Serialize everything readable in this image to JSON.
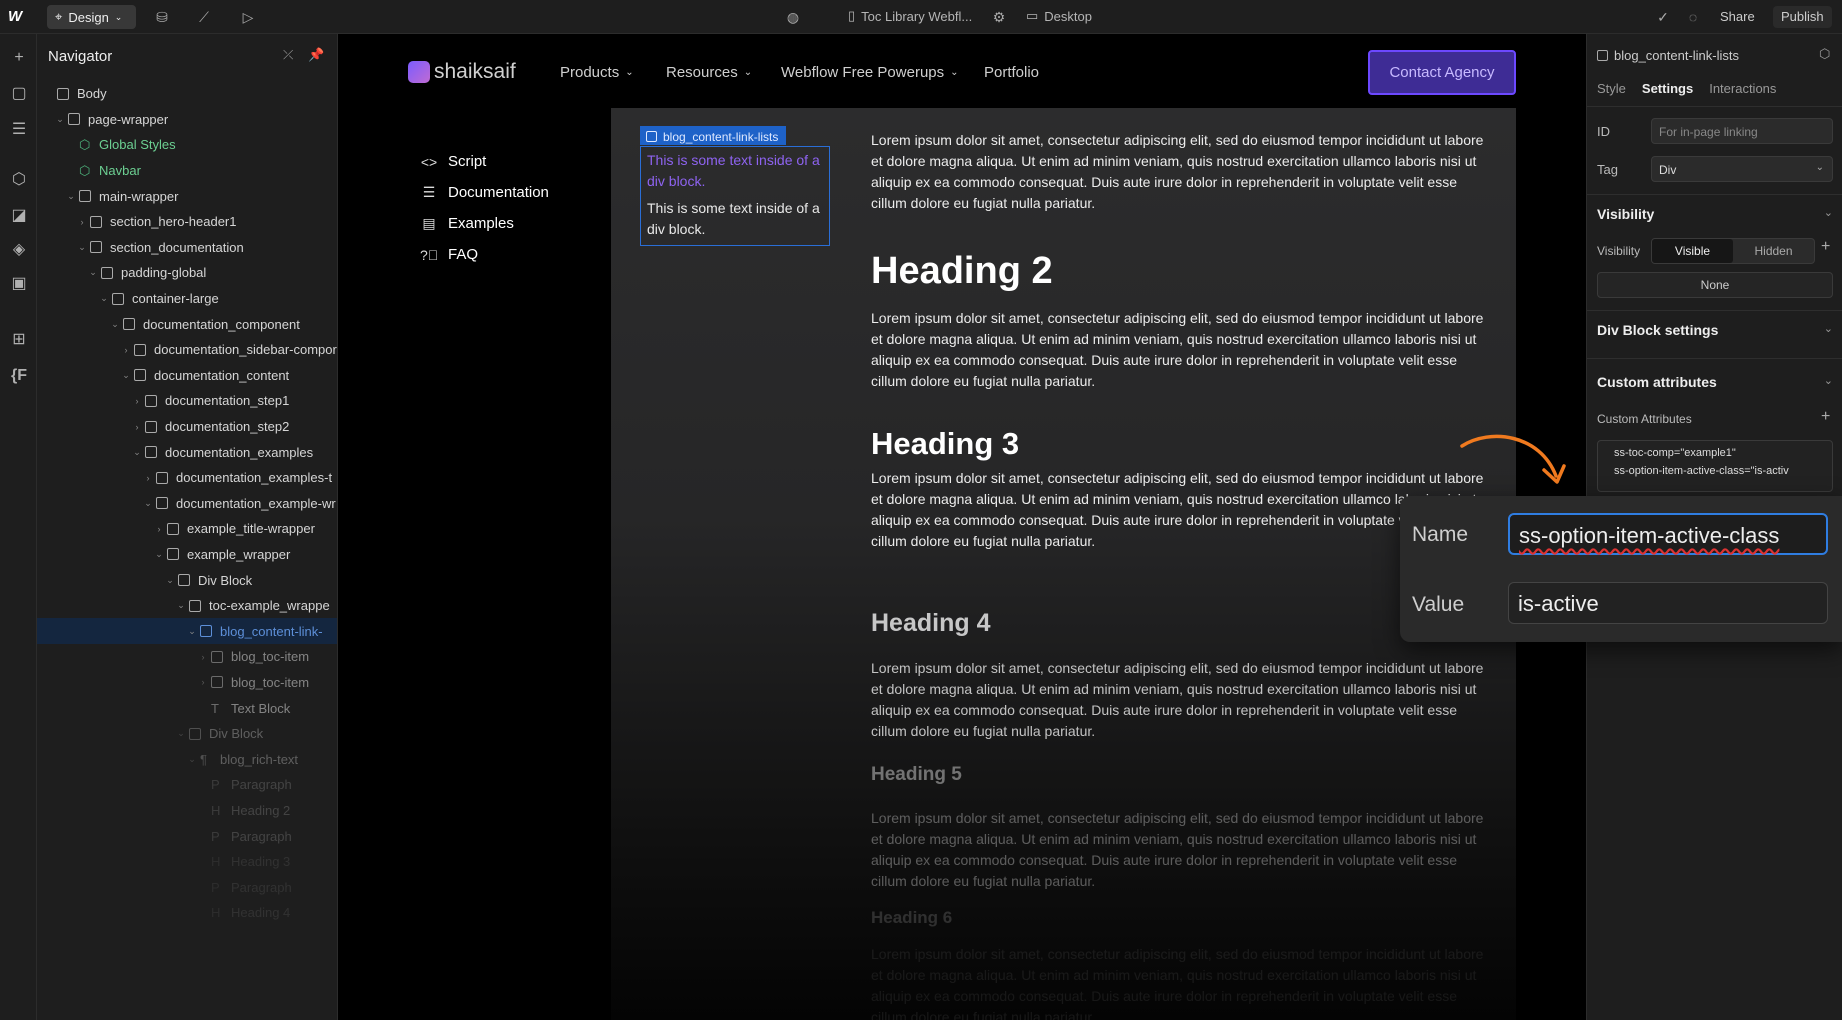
{
  "topbar": {
    "logo": "W",
    "mode_label": "Design",
    "page_name": "Toc Library Webfl...",
    "breakpoint_label": "Desktop",
    "share_label": "Share",
    "publish_label": "Publish"
  },
  "navigator": {
    "title": "Navigator",
    "tree": [
      {
        "label": "Body",
        "depth": 0,
        "chev": "",
        "kind": "box"
      },
      {
        "label": "page-wrapper",
        "depth": 1,
        "chev": "v",
        "kind": "box"
      },
      {
        "label": "Global Styles",
        "depth": 2,
        "chev": "",
        "kind": "component"
      },
      {
        "label": "Navbar",
        "depth": 2,
        "chev": "",
        "kind": "component"
      },
      {
        "label": "main-wrapper",
        "depth": 2,
        "chev": "v",
        "kind": "box"
      },
      {
        "label": "section_hero-header1",
        "depth": 3,
        "chev": ">",
        "kind": "box"
      },
      {
        "label": "section_documentation",
        "depth": 3,
        "chev": "v",
        "kind": "box"
      },
      {
        "label": "padding-global",
        "depth": 4,
        "chev": "v",
        "kind": "box"
      },
      {
        "label": "container-large",
        "depth": 5,
        "chev": "v",
        "kind": "box"
      },
      {
        "label": "documentation_component",
        "depth": 6,
        "chev": "v",
        "kind": "box"
      },
      {
        "label": "documentation_sidebar-compor",
        "depth": 7,
        "chev": ">",
        "kind": "box"
      },
      {
        "label": "documentation_content",
        "depth": 7,
        "chev": "v",
        "kind": "box"
      },
      {
        "label": "documentation_step1",
        "depth": 8,
        "chev": ">",
        "kind": "box"
      },
      {
        "label": "documentation_step2",
        "depth": 8,
        "chev": ">",
        "kind": "box"
      },
      {
        "label": "documentation_examples",
        "depth": 8,
        "chev": "v",
        "kind": "box"
      },
      {
        "label": "documentation_examples-t",
        "depth": 9,
        "chev": ">",
        "kind": "box"
      },
      {
        "label": "documentation_example-wr",
        "depth": 9,
        "chev": "v",
        "kind": "box"
      },
      {
        "label": "example_title-wrapper",
        "depth": 10,
        "chev": ">",
        "kind": "box"
      },
      {
        "label": "example_wrapper",
        "depth": 10,
        "chev": "v",
        "kind": "box"
      },
      {
        "label": "Div Block",
        "depth": 11,
        "chev": "v",
        "kind": "box"
      },
      {
        "label": "toc-example_wrappe",
        "depth": 12,
        "chev": "v",
        "kind": "box"
      },
      {
        "label": "blog_content-link-",
        "depth": 13,
        "chev": "v",
        "kind": "box",
        "selected": true
      },
      {
        "label": "blog_toc-item",
        "depth": 14,
        "chev": ">",
        "kind": "box",
        "fade": 1
      },
      {
        "label": "blog_toc-item",
        "depth": 14,
        "chev": ">",
        "kind": "box",
        "fade": 1
      },
      {
        "label": "Text Block",
        "depth": 14,
        "chev": "",
        "kind": "text",
        "fade": 1
      },
      {
        "label": "Div Block",
        "depth": 12,
        "chev": "v",
        "kind": "box",
        "fade": 2
      },
      {
        "label": "blog_rich-text",
        "depth": 13,
        "chev": "v",
        "kind": "rich",
        "fade": 2
      },
      {
        "label": "Paragraph",
        "depth": 14,
        "chev": "",
        "kind": "para",
        "fade": 3
      },
      {
        "label": "Heading 2",
        "depth": 14,
        "chev": "",
        "kind": "heading",
        "fade": 3
      },
      {
        "label": "Paragraph",
        "depth": 14,
        "chev": "",
        "kind": "para",
        "fade": 3
      },
      {
        "label": "Heading 3",
        "depth": 14,
        "chev": "",
        "kind": "heading",
        "fade": 4
      },
      {
        "label": "Paragraph",
        "depth": 14,
        "chev": "",
        "kind": "para",
        "fade": 4
      },
      {
        "label": "Heading 4",
        "depth": 14,
        "chev": "",
        "kind": "heading",
        "fade": 4
      }
    ]
  },
  "site": {
    "brand": "shaiksaif",
    "nav": [
      "Products",
      "Resources",
      "Webflow Free Powerups",
      "Portfolio"
    ],
    "cta_label": "Contact Agency",
    "sidebar": [
      "Script",
      "Documentation",
      "Examples",
      "FAQ"
    ],
    "toc_class_label": "blog_content-link-lists",
    "toc_texts": [
      "This is some text inside of a div block.",
      "This is some text inside of a div block."
    ],
    "paragraph": "Lorem ipsum dolor sit amet, consectetur adipiscing elit, sed do eiusmod tempor incididunt ut labore et dolore magna aliqua. Ut enim ad minim veniam, quis nostrud exercitation ullamco laboris nisi ut aliquip ex ea commodo consequat. Duis aute irure dolor in reprehenderit in voluptate velit esse cillum dolore eu fugiat nulla pariatur.",
    "headings": [
      "Heading 2",
      "Heading 3",
      "Heading 4",
      "Heading 5",
      "Heading 6"
    ]
  },
  "panel": {
    "element_name": "blog_content-link-lists",
    "tabs": [
      "Style",
      "Settings",
      "Interactions"
    ],
    "id_label": "ID",
    "id_placeholder": "For in-page linking",
    "tag_label": "Tag",
    "tag_value": "Div",
    "visibility_section": "Visibility",
    "visibility_label": "Visibility",
    "visible_option": "Visible",
    "hidden_option": "Hidden",
    "none_label": "None",
    "div_settings_section": "Div Block settings",
    "custom_attr_section": "Custom attributes",
    "custom_attr_label": "Custom Attributes",
    "attributes": [
      "ss-toc-comp=\"example1\"",
      "ss-option-item-active-class=\"is-activ"
    ]
  },
  "popup": {
    "name_label": "Name",
    "name_value": "ss-option-item-active-class",
    "value_label": "Value",
    "value_value": "is-active"
  },
  "colors": {
    "accent": "#2f7de1",
    "cta_border": "#6c48ff",
    "arrow": "#f07a1f",
    "component_green": "#6ccf92"
  }
}
